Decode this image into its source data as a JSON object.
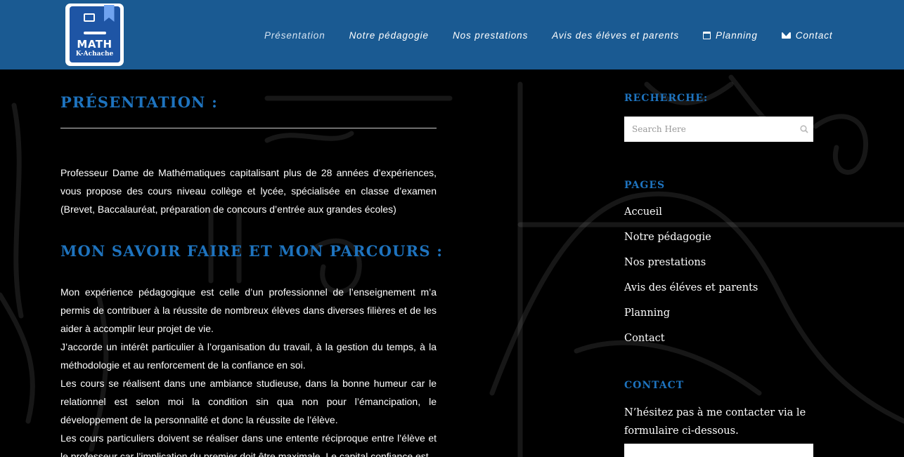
{
  "brand": {
    "logo_title": "MATH",
    "logo_subtitle": "K-Achache"
  },
  "nav": {
    "items": [
      {
        "label": "Présentation",
        "icon": null,
        "active": true
      },
      {
        "label": "Notre pédagogie",
        "icon": null
      },
      {
        "label": "Nos prestations",
        "icon": null
      },
      {
        "label": "Avis des éléves et parents",
        "icon": null
      },
      {
        "label": "Planning",
        "icon": "calendar-icon"
      },
      {
        "label": "Contact",
        "icon": "envelope-icon"
      }
    ]
  },
  "main": {
    "heading_presentation": "PRÉSENTATION :",
    "intro": "Professeur Dame de Mathématiques capitalisant  plus de 28 années d’expériences, vous propose des cours niveau collège et lycée, spécialisée en classe d’examen (Brevet, Baccalauréat, préparation de concours d’entrée aux grandes écoles)",
    "heading_savoir": "MON SAVOIR FAIRE ET MON PARCOURS :",
    "paragraphs": [
      "Mon expérience pédagogique est celle d’un professionnel de l’enseignement m’a permis de contribuer à la réussite de nombreux élèves dans diverses filières et de les aider à accomplir leur projet de vie.",
      "J’accorde un intérêt particulier à l’organisation du travail, à la gestion du temps, à la méthodologie et au renforcement de la confiance en soi.",
      "Les cours se réalisent dans une ambiance studieuse, dans la bonne humeur car le relationnel est selon moi la condition sin qua non pour l’émancipation, le développement de la personnalité et donc la réussite de l’élève.",
      "Les cours particuliers doivent se réaliser dans une entente réciproque entre l’élève et le professeur car l’implication du premier doit être maximale. Le capital confiance est"
    ]
  },
  "sidebar": {
    "search_heading": "RECHERCHE:",
    "search_placeholder": "Search Here",
    "pages_heading": "PAGES",
    "pages": [
      "Accueil",
      "Notre pédagogie",
      "Nos prestations",
      "Avis des éléves et parents",
      "Planning",
      "Contact"
    ],
    "contact_heading": "CONTACT",
    "contact_text": "N’hésitez pas à me contacter via le formulaire ci-dessous."
  },
  "colors": {
    "header_bg": "#1a5a92",
    "accent": "#1e73be",
    "page_bg": "#000000"
  }
}
